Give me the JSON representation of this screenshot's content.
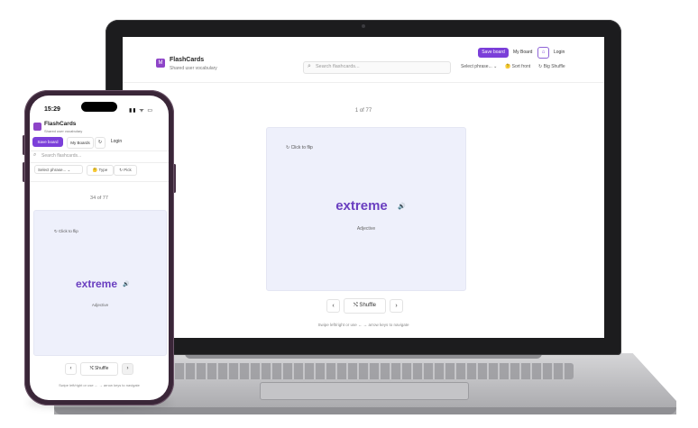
{
  "app": {
    "title": "FlashCards",
    "subtitle": "Shared user vocabulary",
    "logo_letter": "M",
    "accent": "#7b3fd9",
    "word_color": "#6a3fc0"
  },
  "desktop": {
    "search": {
      "icon": "search-icon",
      "placeholder": "Search flashcards..."
    },
    "filters": {
      "select": "Select phrase... ⌄",
      "type": "🤔 Sort front",
      "pos": "↻ Big Shuffle"
    },
    "header_buttons": {
      "primary": "Save board",
      "link": "My Board",
      "icon": "user-icon",
      "login": "Login"
    },
    "counter": "1 of 77",
    "card": {
      "hint": "↻ Click to flip",
      "word": "extreme",
      "speaker": "🔊",
      "part_of_speech": "Adjective"
    },
    "nav": {
      "prev": "‹",
      "shuffle": "⤭  Shuffle",
      "next": "›"
    },
    "footer": "Swipe left/right or use ← → arrow keys to navigate"
  },
  "phone": {
    "time": "15:29",
    "status": "▮▮ ᯤ ▭",
    "header_buttons": {
      "primary": "Save board",
      "link": "My Boards",
      "icon": "↻",
      "login": "Login"
    },
    "search": {
      "icon": "search-icon",
      "placeholder": "Search flashcards..."
    },
    "filters": {
      "select": "Select phrase... ⌄",
      "type": "🤔 Type",
      "pos": "↻ Pick"
    },
    "counter": "34 of 77",
    "card": {
      "hint": "↻ Click to flip",
      "word": "extreme",
      "speaker": "🔊",
      "part_of_speech": "Adjective"
    },
    "nav": {
      "prev": "‹",
      "shuffle": "⤭  Shuffle",
      "next": "›"
    },
    "footer": "Swipe left/right or use ← → arrow keys to navigate"
  }
}
